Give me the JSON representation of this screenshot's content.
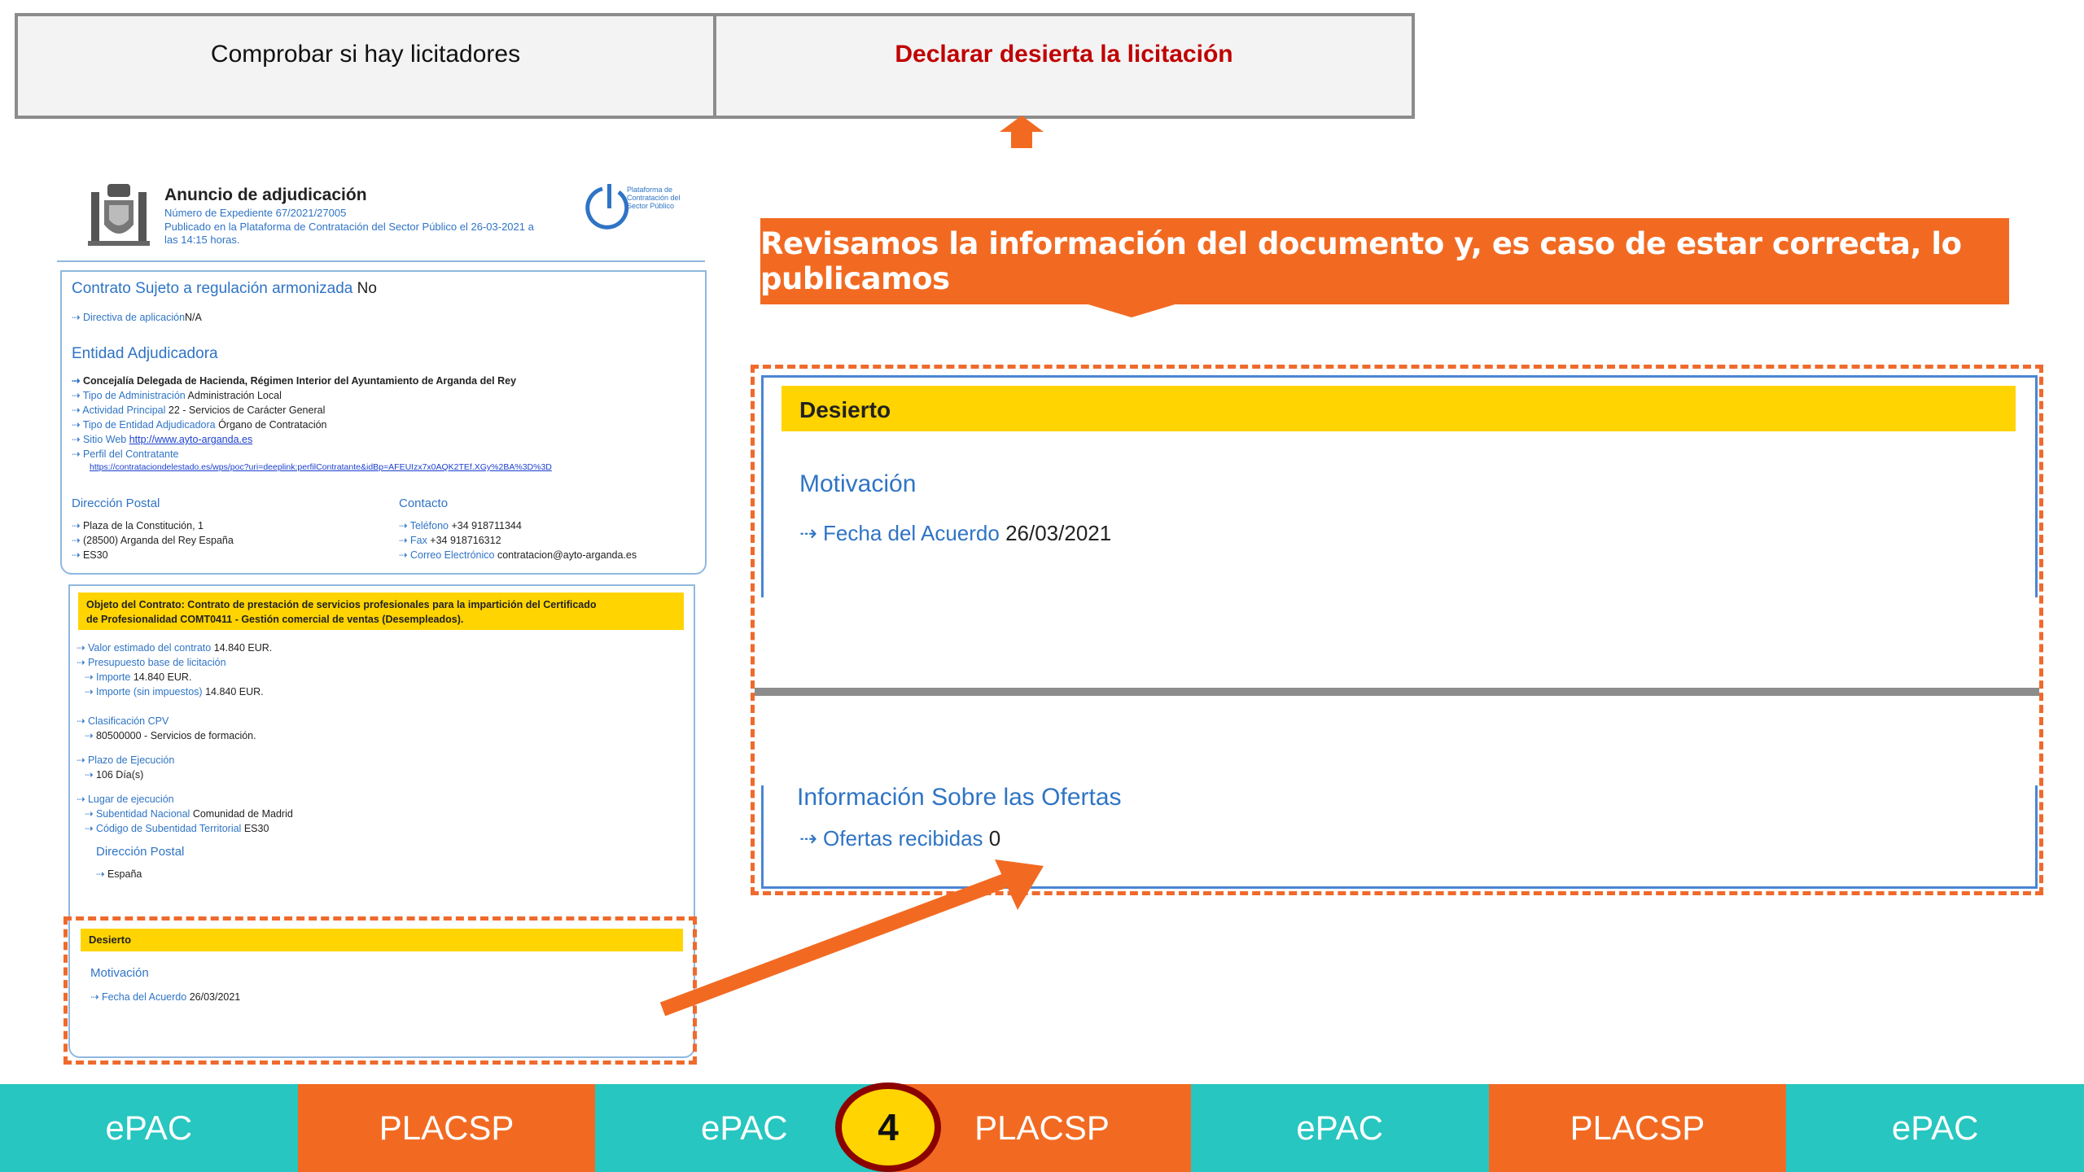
{
  "tabs": [
    {
      "label": "Comprobar si hay licitadores",
      "active": false
    },
    {
      "label": "Declarar desierta la licitación",
      "active": true
    }
  ],
  "banner": "Revisamos la información del documento y, es caso de estar correcta, lo publicamos",
  "doc": {
    "title": "Anuncio de adjudicación",
    "expediente": "Número de Expediente 67/2021/27005",
    "publicado_1": "Publicado en la Plataforma de Contratación del Sector Público el 26-03-2021 a",
    "publicado_2": "las 14:15 horas.",
    "platform_logo_text": "Plataforma de Contratación del Sector Público",
    "contrato_label": "Contrato Sujeto a regulación armonizada",
    "contrato_value": "No",
    "directiva_label": "Directiva de aplicación",
    "directiva_value": "N/A",
    "entidad_heading": "Entidad Adjudicadora",
    "entidad_name": "Concejalía Delegada de Hacienda, Régimen Interior del Ayuntamiento de Arganda del Rey",
    "tipo_admin_label": "Tipo de Administración",
    "tipo_admin_value": "Administración Local",
    "actividad_label": "Actividad Principal",
    "actividad_value": "22 - Servicios de Carácter General",
    "tipo_entidad_label": "Tipo de Entidad Adjudicadora",
    "tipo_entidad_value": "Órgano de Contratación",
    "sitio_label": "Sitio Web",
    "sitio_value": "http://www.ayto-arganda.es",
    "perfil_label": "Perfil del Contratante",
    "perfil_value": "https://contrataciondelestado.es/wps/poc?uri=deeplink:perfilContratante&idBp=AFEUIzx7x0AQK2TEf.XGy%2BA%3D%3D",
    "direccion_heading": "Dirección Postal",
    "dir_1": "Plaza de la Constitución, 1",
    "dir_2": "(28500) Arganda del Rey España",
    "dir_3": "ES30",
    "contacto_heading": "Contacto",
    "telefono_label": "Teléfono",
    "telefono_value": "+34 918711344",
    "fax_label": "Fax",
    "fax_value": "+34 918716312",
    "correo_label": "Correo Electrónico",
    "correo_value": "contratacion@ayto-arganda.es",
    "objeto_1": "Objeto del Contrato: Contrato de prestación de servicios profesionales para la impartición del Certificado",
    "objeto_2": "de Profesionalidad COMT0411 - Gestión comercial de ventas (Desempleados).",
    "valor_label": "Valor estimado del contrato",
    "valor_value": "14.840 EUR.",
    "presupuesto_label": "Presupuesto base de licitación",
    "importe_label": "Importe",
    "importe_value": "14.840 EUR.",
    "importe_sin_label": "Importe (sin impuestos)",
    "importe_sin_value": "14.840 EUR.",
    "cpv_label": "Clasificación CPV",
    "cpv_value": "80500000 - Servicios de formación.",
    "plazo_label": "Plazo de Ejecución",
    "plazo_value": "106 Día(s)",
    "lugar_label": "Lugar de ejecución",
    "subentidad_label": "Subentidad Nacional",
    "subentidad_value": "Comunidad de Madrid",
    "codigo_label": "Código de Subentidad Territorial",
    "codigo_value": "ES30",
    "dir_heading_2": "Dirección Postal",
    "pais": "España",
    "desierto": "Desierto",
    "motivacion": "Motivación",
    "fecha_label": "Fecha del Acuerdo",
    "fecha_value": "26/03/2021"
  },
  "panel": {
    "desierto": "Desierto",
    "motivacion": "Motivación",
    "fecha_label": "Fecha del Acuerdo",
    "fecha_value": "26/03/2021",
    "ofertas_heading": "Información Sobre las Ofertas",
    "ofertas_label": "Ofertas recibidas",
    "ofertas_value": "0"
  },
  "nav": [
    "ePAC",
    "PLACSP",
    "ePAC",
    "PLACSP",
    "ePAC",
    "PLACSP",
    "ePAC"
  ],
  "step": "4",
  "colors": {
    "orange": "#f26a22",
    "teal": "#27c6c0",
    "yellow": "#ffd400",
    "blue": "#2f74c5",
    "dark_red": "#8b0000"
  }
}
